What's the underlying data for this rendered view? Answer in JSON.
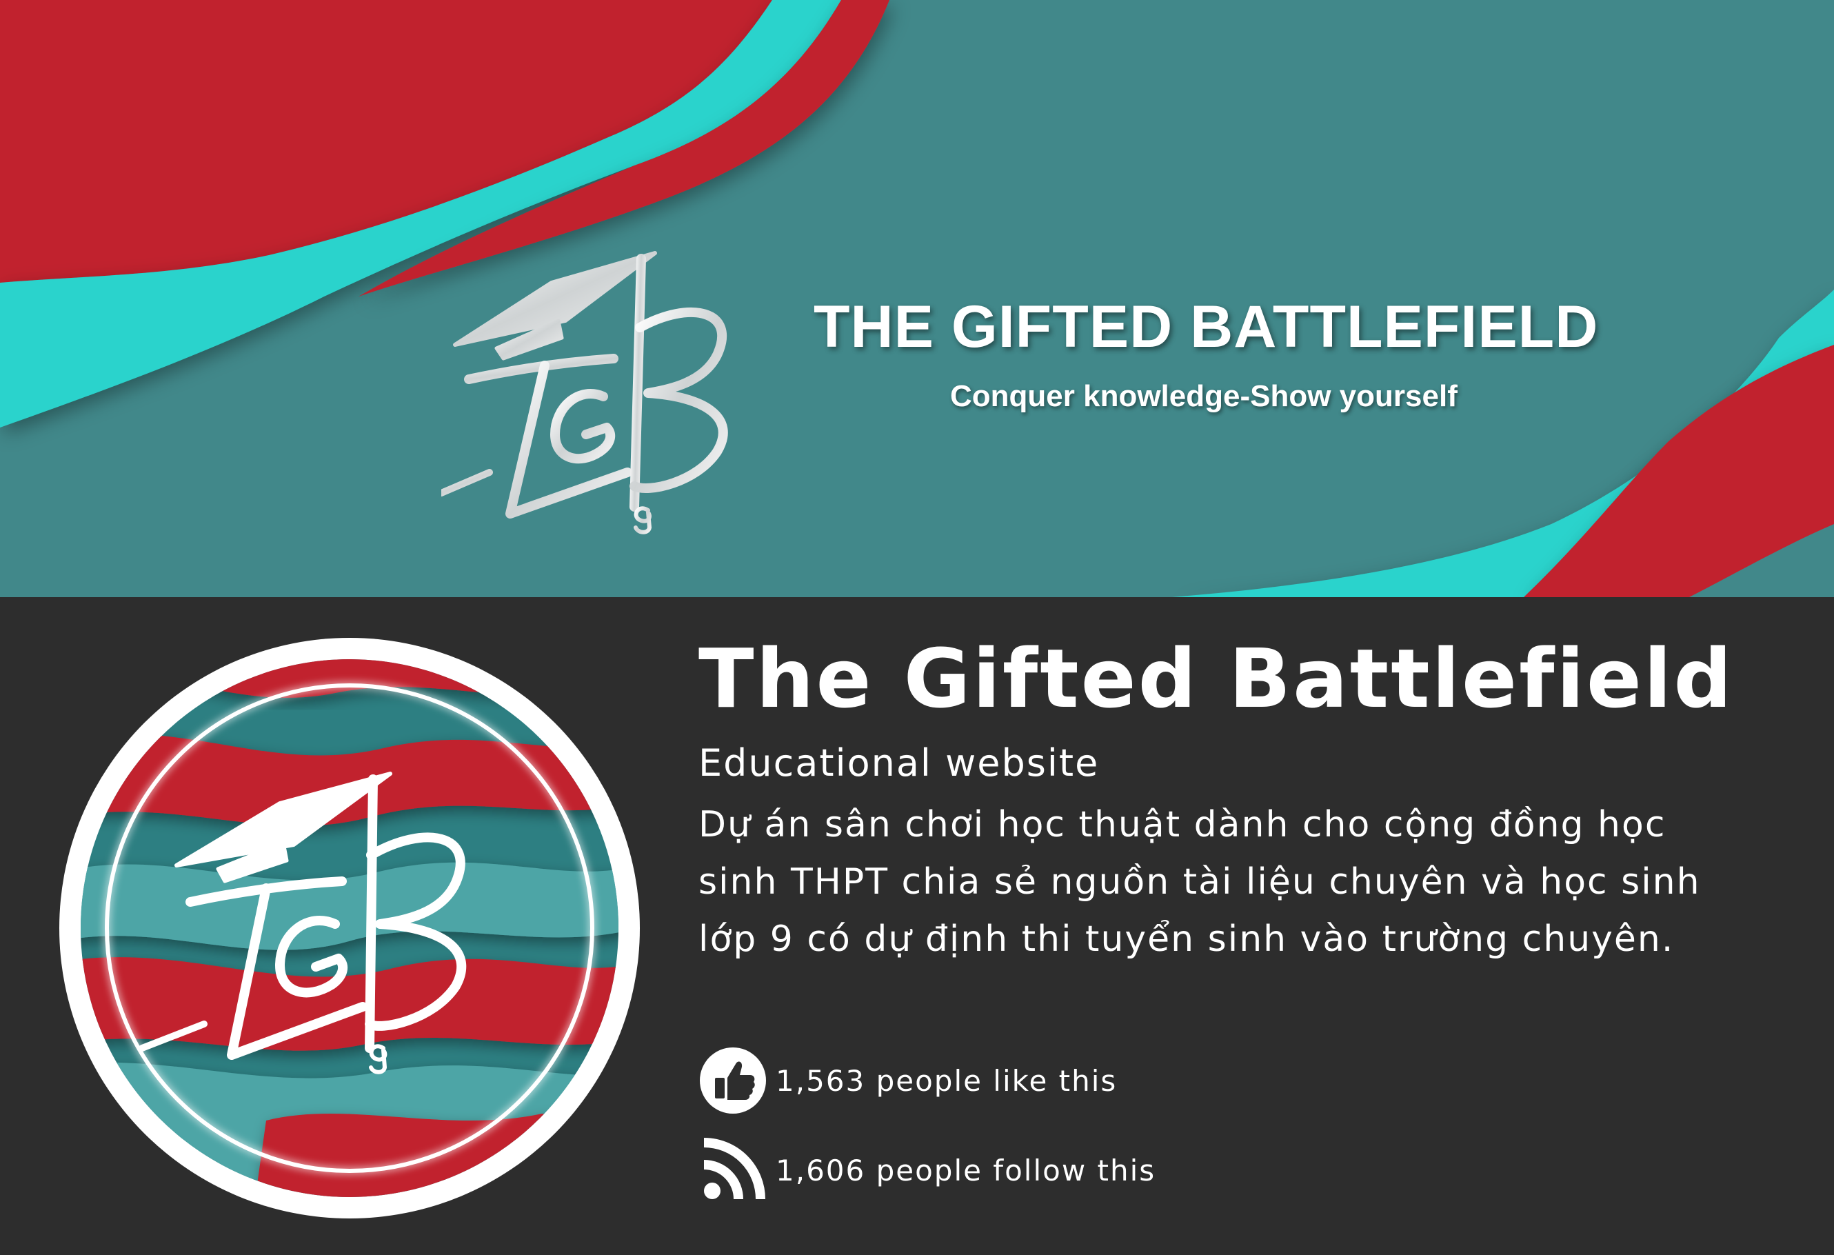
{
  "cover": {
    "title": "THE GIFTED BATTLEFIELD",
    "tagline": "Conquer knowledge-Show yourself",
    "logo": "tgb-graduation-cap-logo"
  },
  "profile": {
    "name": "The Gifted Battlefield",
    "category": "Educational website",
    "description": "Dự án sân chơi học thuật dành cho cộng đồng học sinh THPT chia sẻ nguồn tài liệu chuyên và học sinh lớp 9 có dự định thi tuyển sinh vào trường chuyên.",
    "likes_text": "1,563 people like this",
    "follows_text": "1,606 people follow this",
    "like_icon": "thumbs-up-icon",
    "follow_icon": "rss-feed-icon"
  },
  "colors": {
    "teal_dark": "#41888a",
    "teal_bright": "#2ad3cc",
    "red": "#c1232e",
    "panel": "#2d2d2d",
    "text": "#ffffff"
  }
}
